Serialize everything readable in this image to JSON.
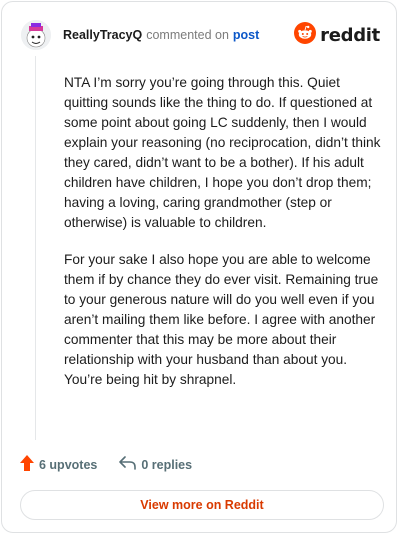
{
  "header": {
    "username": "ReallyTracyQ",
    "action_text": "commented on",
    "post_link_label": "post",
    "logo_text": "reddit",
    "logo_icon": "reddit-alien-icon",
    "avatar_icon": "user-avatar"
  },
  "comment": {
    "paragraphs": [
      "NTA I’m sorry you’re going through this. Quiet quitting sounds like the thing to do. If questioned at some point about going LC suddenly, then I would explain your reasoning (no reciprocation, didn’t think they cared, didn’t want to be a bother). If his adult children have children, I hope you don’t drop them; having a loving, caring grandmother (step or otherwise) is valuable to children.",
      "For your sake I also hope you are able to welcome them if by chance they do ever visit. Remaining true to your generous nature will do you well even if you aren’t mailing them like before. I agree with another commenter that this may be more about their relationship with your husband than about you. You’re being hit by shrapnel."
    ]
  },
  "footer": {
    "upvotes_label": "6 upvotes",
    "upvote_icon": "upvote-arrow-icon",
    "replies_label": "0 replies",
    "reply_icon": "reply-arrow-icon",
    "view_more_label": "View more on Reddit"
  },
  "colors": {
    "brand": "#ff4500",
    "link": "#0b57c8",
    "view_more": "#d93a00"
  }
}
